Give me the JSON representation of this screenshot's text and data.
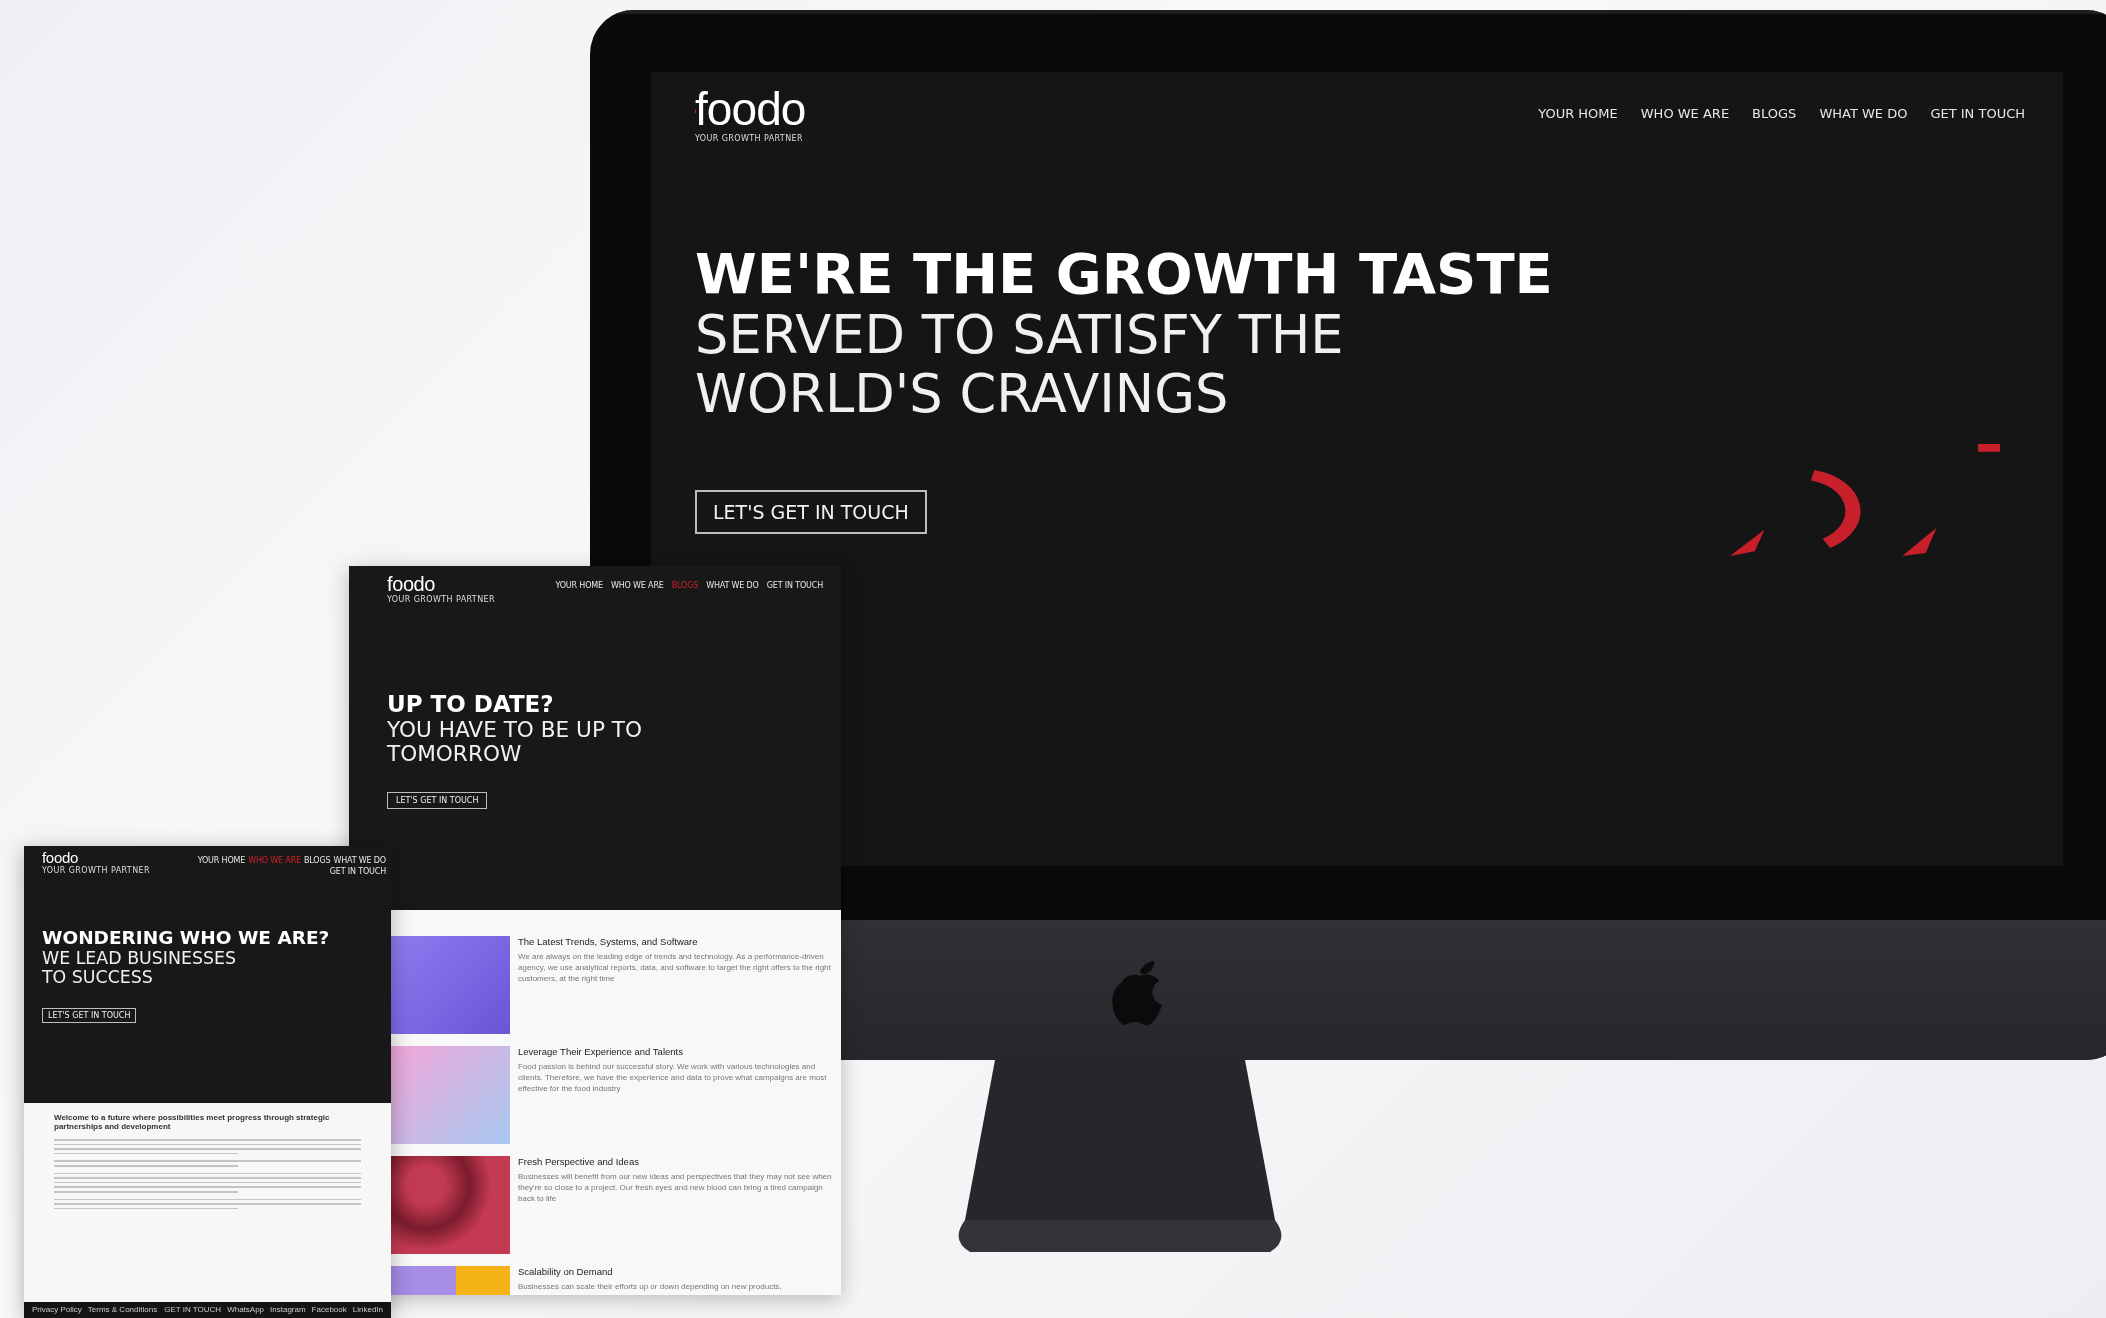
{
  "monitor": {
    "logo": {
      "name": "foodo",
      "tagline": "YOUR GROWTH PARTNER"
    },
    "nav": [
      {
        "label": "YOUR HOME",
        "selected": false
      },
      {
        "label": "WHO WE ARE",
        "selected": false
      },
      {
        "label": "BLOGS",
        "selected": false
      },
      {
        "label": "WHAT WE DO",
        "selected": false
      },
      {
        "label": "GET IN TOUCH",
        "selected": false
      }
    ],
    "hero": [
      {
        "text": "WE'RE THE GROWTH TASTE",
        "kind": "strong"
      },
      {
        "text": "SERVED TO SATISFY THE",
        "kind": "light"
      },
      {
        "text": "WORLD'S CRAVINGS",
        "kind": "light"
      }
    ],
    "cta": "LET'S GET IN TOUCH"
  },
  "blogs_page": {
    "logo": {
      "name": "foodo",
      "tagline": "YOUR GROWTH PARTNER"
    },
    "nav": [
      {
        "label": "YOUR HOME",
        "selected": false
      },
      {
        "label": "WHO WE ARE",
        "selected": false
      },
      {
        "label": "BLOGS",
        "selected": true
      },
      {
        "label": "WHAT WE DO",
        "selected": false
      },
      {
        "label": "GET IN TOUCH",
        "selected": false
      }
    ],
    "hero": [
      {
        "text": "UP TO DATE?",
        "kind": "strong"
      },
      {
        "text": "YOU HAVE TO BE UP TO",
        "kind": "light"
      },
      {
        "text": "TOMORROW",
        "kind": "light"
      }
    ],
    "cta": "LET'S GET IN TOUCH",
    "posts": [
      {
        "title": "The Latest Trends, Systems, and Software",
        "text": "We are always on the leading edge of trends and technology. As a performance-driven agency, we use analytical reports, data, and software to target the right offers to the right customers, at the right time"
      },
      {
        "title": "Leverage Their Experience and Talents",
        "text": "Food passion is behind our successful story. We work with various technologies and clients. Therefore, we have the experience and data to prove what campaigns are most effective for the food industry"
      },
      {
        "title": "Fresh Perspective and Ideas",
        "text": "Businesses will benefit from our new ideas and perspectives that they may not see when they're so close to a project. Our fresh eyes and new blood can bring a tired campaign back to life"
      },
      {
        "title": "Scalability on Demand",
        "text": "Businesses can scale their efforts up or down depending on new products,"
      }
    ]
  },
  "about_page": {
    "logo": {
      "name": "foodo",
      "tagline": "YOUR GROWTH PARTNER"
    },
    "nav": [
      {
        "label": "YOUR HOME",
        "selected": false
      },
      {
        "label": "WHO WE ARE",
        "selected": true
      },
      {
        "label": "BLOGS",
        "selected": false
      },
      {
        "label": "WHAT WE DO",
        "selected": false
      },
      {
        "label": "GET IN TOUCH",
        "selected": false
      }
    ],
    "hero": [
      {
        "text": "WONDERING WHO WE ARE?",
        "kind": "strong"
      },
      {
        "text": "WE LEAD BUSINESSES",
        "kind": "light"
      },
      {
        "text": "TO SUCCESS",
        "kind": "light"
      }
    ],
    "cta": "LET'S GET IN TOUCH",
    "intro": "Welcome to a future where possibilities meet progress through strategic partnerships and development",
    "footer": {
      "left": [
        "Privacy Policy",
        "Terms & Conditions"
      ],
      "right": [
        "GET IN TOUCH",
        "WhatsApp",
        "Instagram",
        "Facebook",
        "LinkedIn"
      ]
    }
  }
}
